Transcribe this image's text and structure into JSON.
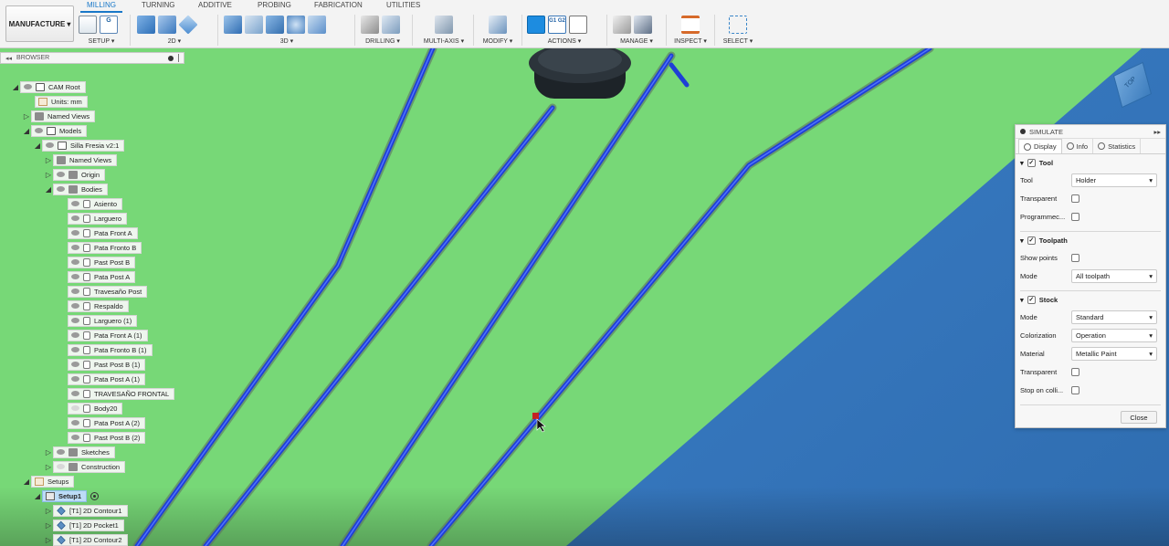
{
  "toolbar": {
    "workspace": "MANUFACTURE",
    "tabs": [
      "MILLING",
      "TURNING",
      "ADDITIVE",
      "PROBING",
      "FABRICATION",
      "UTILITIES"
    ],
    "groups": {
      "setup": "SETUP ▾",
      "two_d": "2D ▾",
      "three_d": "3D ▾",
      "drilling": "DRILLING ▾",
      "multi_axis": "MULTI-AXIS ▾",
      "modify": "MODIFY ▾",
      "actions": "ACTIONS ▾",
      "manage": "MANAGE ▾",
      "inspect": "INSPECT ▾",
      "select": "SELECT ▾"
    },
    "gcode_icon": "G1 G2"
  },
  "browser": {
    "title": "BROWSER",
    "items": [
      {
        "label": "CAM Root",
        "icon": "comp",
        "tri": "down"
      },
      {
        "label": "Units: mm",
        "icon": "doc",
        "tri": ""
      },
      {
        "label": "Named Views",
        "icon": "folder",
        "tri": "right"
      },
      {
        "label": "Models",
        "icon": "comp",
        "tri": "down"
      },
      {
        "label": "Silla Fresia v2:1",
        "icon": "comp",
        "tri": "down"
      },
      {
        "label": "Named Views",
        "icon": "folder",
        "tri": "right"
      },
      {
        "label": "Origin",
        "icon": "folder",
        "tri": "right"
      },
      {
        "label": "Bodies",
        "icon": "folder",
        "tri": "down"
      },
      {
        "label": "Asiento",
        "icon": "body"
      },
      {
        "label": "Larguero",
        "icon": "body"
      },
      {
        "label": "Pata Front A",
        "icon": "body"
      },
      {
        "label": "Pata Fronto B",
        "icon": "body"
      },
      {
        "label": "Past Post B",
        "icon": "body"
      },
      {
        "label": "Pata Post A",
        "icon": "body"
      },
      {
        "label": "Travesaño Post",
        "icon": "body"
      },
      {
        "label": "Respaldo",
        "icon": "body"
      },
      {
        "label": "Larguero (1)",
        "icon": "body"
      },
      {
        "label": "Pata Front A (1)",
        "icon": "body"
      },
      {
        "label": "Pata Fronto B (1)",
        "icon": "body"
      },
      {
        "label": "Past Post B (1)",
        "icon": "body"
      },
      {
        "label": "Pata Post A (1)",
        "icon": "body"
      },
      {
        "label": "TRAVESAÑO FRONTAL",
        "icon": "body"
      },
      {
        "label": "Body20",
        "icon": "body"
      },
      {
        "label": "Pata Post A (2)",
        "icon": "body"
      },
      {
        "label": "Past Post B (2)",
        "icon": "body"
      },
      {
        "label": "Sketches",
        "icon": "folder",
        "tri": "right"
      },
      {
        "label": "Construction",
        "icon": "folder",
        "tri": "right"
      },
      {
        "label": "Setups",
        "icon": "doc",
        "tri": "down"
      },
      {
        "label": "Setup1",
        "icon": "setup",
        "tri": "down"
      },
      {
        "label": "[T1] 2D Contour1",
        "icon": "op",
        "tri": "right"
      },
      {
        "label": "[T1] 2D Pocket1",
        "icon": "op",
        "tri": "right"
      },
      {
        "label": "[T1] 2D Contour2",
        "icon": "op",
        "tri": "right"
      }
    ]
  },
  "simulate": {
    "title": "SIMULATE",
    "tabs": [
      "Display",
      "Info",
      "Statistics"
    ],
    "tool_section": {
      "title": "Tool",
      "checked": true,
      "tool_label": "Tool",
      "tool_value": "Holder",
      "transparent_label": "Transparent",
      "programmed_label": "Programmec..."
    },
    "toolpath_section": {
      "title": "Toolpath",
      "checked": true,
      "show_points_label": "Show points",
      "mode_label": "Mode",
      "mode_value": "All toolpath"
    },
    "stock_section": {
      "title": "Stock",
      "checked": true,
      "mode_label": "Mode",
      "mode_value": "Standard",
      "colorization_label": "Colorization",
      "colorization_value": "Operation",
      "material_label": "Material",
      "material_value": "Metallic Paint",
      "transparent_label": "Transparent",
      "stop_label": "Stop on colli..."
    },
    "close_label": "Close"
  },
  "viewcube": {
    "face": "TOP"
  },
  "colors": {
    "stock_green": "#77d877",
    "background_blue": "#3e7ec2",
    "toolpath_blue": "#1f3fd6",
    "accent": "#1a78c8"
  }
}
